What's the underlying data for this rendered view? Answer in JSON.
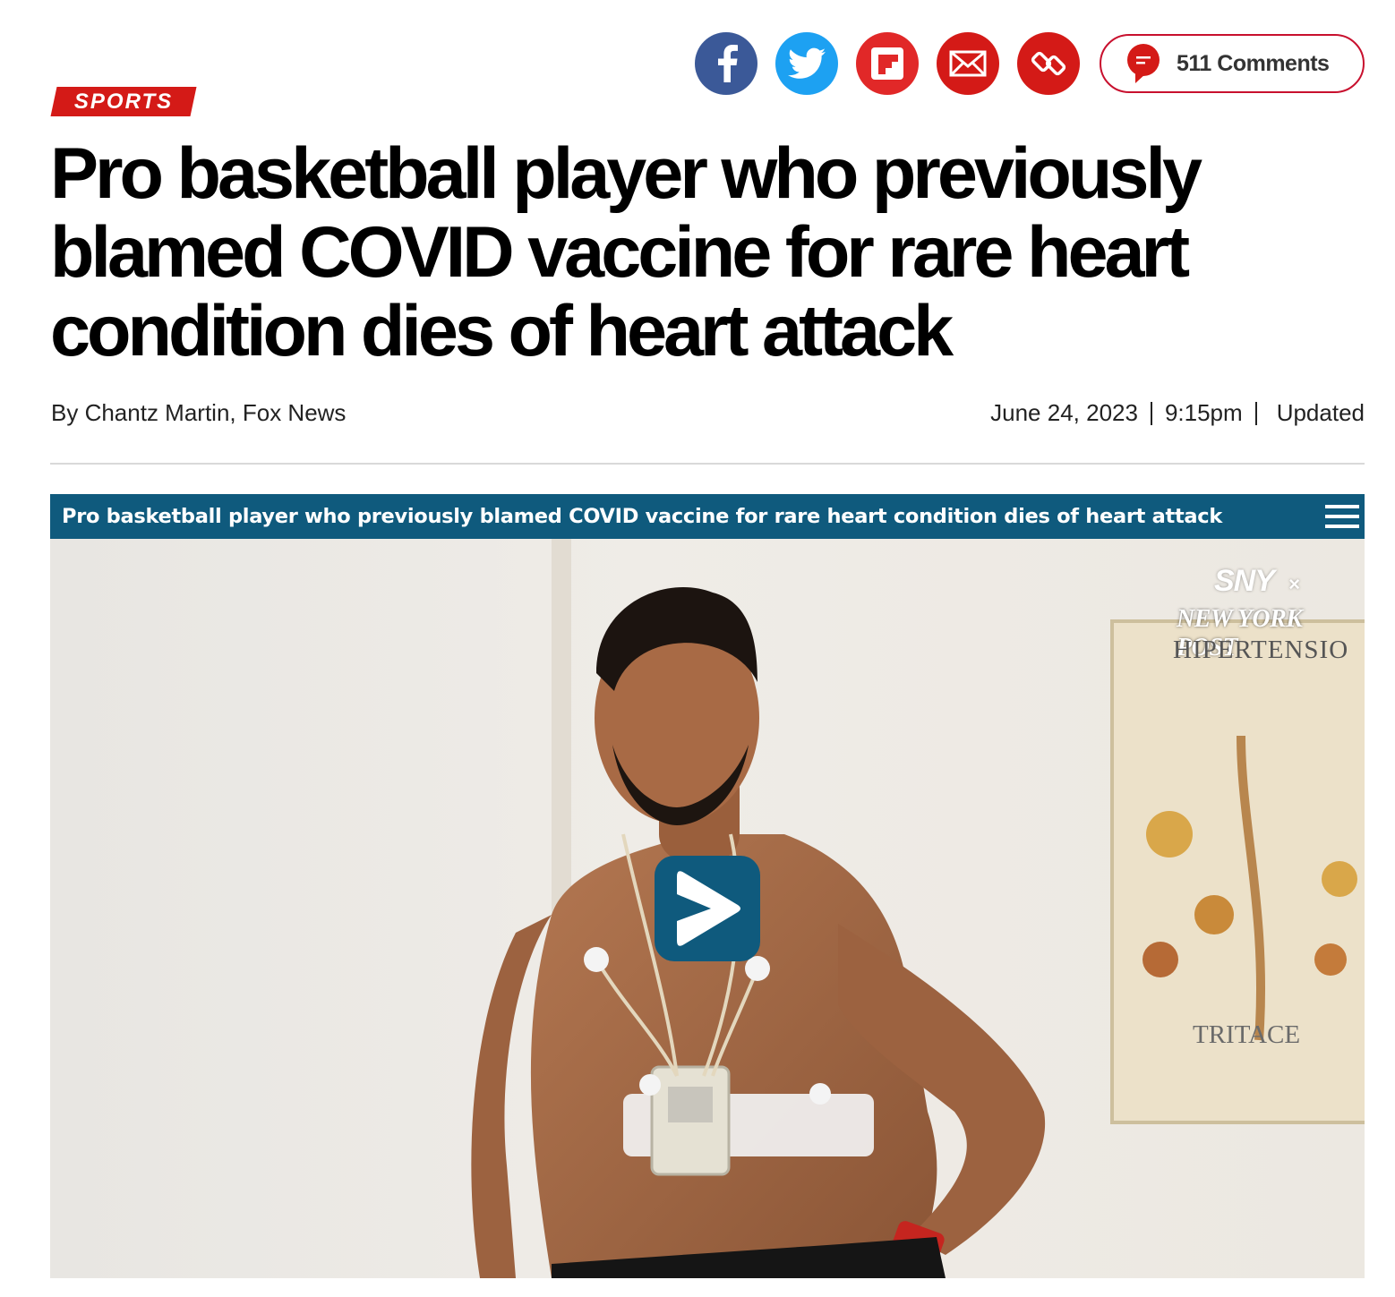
{
  "share": {
    "facebook": "facebook-icon",
    "twitter": "twitter-icon",
    "flipboard": "flipboard-icon",
    "email": "email-icon",
    "link": "link-icon",
    "comments_label": "511 Comments"
  },
  "colors": {
    "brand_red": "#d41a17",
    "facebook": "#3b5998",
    "twitter": "#1da1f2",
    "flipboard": "#e12828",
    "player_bar": "#0f5a7d"
  },
  "article": {
    "category": "SPORTS",
    "headline": "Pro basketball player who previously blamed COVID vaccine for rare heart condition dies of heart attack",
    "byline": "By Chantz Martin, Fox News",
    "date": "June 24, 2023",
    "time": "9:15pm",
    "updated_label": "Updated"
  },
  "video": {
    "title": "Pro basketball player who previously blamed COVID vaccine for rare heart condition dies of heart attack",
    "watermark_network": "SNY",
    "watermark_x": "×",
    "watermark_publication": "NEW YORK POST",
    "poster_title": "HIPERTENSIO",
    "poster_brand": "TRITACE"
  }
}
